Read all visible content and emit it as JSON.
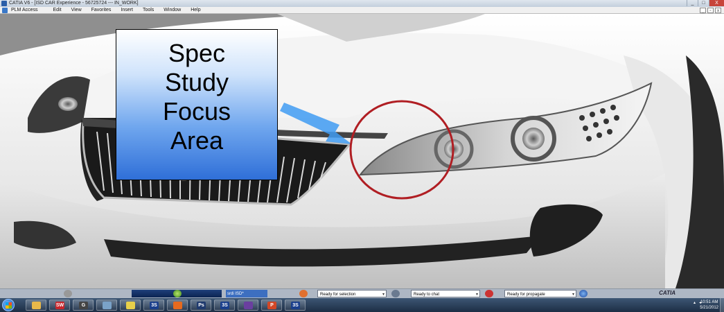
{
  "window": {
    "title": "CATIA V6 - [ISD CAR Experience - 56725724 --- IN_WORK]",
    "minimize": "_",
    "maximize": "□",
    "close": "X"
  },
  "menu": {
    "items": [
      "PLM Access",
      "Edit",
      "View",
      "Favorites",
      "Insert",
      "Tools",
      "Window",
      "Help"
    ],
    "mdi_minimize": "_",
    "mdi_restore": "▫",
    "mdi_close": "x"
  },
  "callout": {
    "lines": [
      "Spec",
      "Study",
      "Focus",
      "Area"
    ]
  },
  "annotation": {
    "circle_color": "#b01e23",
    "arrow_color": "#3f9bf2",
    "callout_gradient_top": "#ffffff",
    "callout_gradient_bottom": "#2f6fd8"
  },
  "statusbar": {
    "search_value": "srdi ISD*",
    "selection_status": "Ready for selection",
    "chat_status": "Ready to chat",
    "propagate_status": "Ready for propagate",
    "logo": "CATIA"
  },
  "taskbar": {
    "apps": [
      {
        "name": "explorer",
        "glyph": "",
        "color": "#e8b84a"
      },
      {
        "name": "solidworks",
        "glyph": "SW",
        "color": "#c8262c"
      },
      {
        "name": "app-g",
        "glyph": "G",
        "color": "#444444"
      },
      {
        "name": "network",
        "glyph": "",
        "color": "#7aa2c8"
      },
      {
        "name": "lightbulb",
        "glyph": "",
        "color": "#e8d04a"
      },
      {
        "name": "catia-1",
        "glyph": "3S",
        "color": "#1a3f8c"
      },
      {
        "name": "firefox",
        "glyph": "",
        "color": "#e66a1f"
      },
      {
        "name": "photoshop",
        "glyph": "Ps",
        "color": "#1f3a6e"
      },
      {
        "name": "catia-2",
        "glyph": "3S",
        "color": "#1a3f8c"
      },
      {
        "name": "media",
        "glyph": "",
        "color": "#6a3fa0"
      },
      {
        "name": "powerpoint",
        "glyph": "P",
        "color": "#d24726"
      },
      {
        "name": "catia-3",
        "glyph": "3S",
        "color": "#1a3f8c"
      }
    ],
    "time": "10:51 AM",
    "date": "5/21/2012"
  }
}
